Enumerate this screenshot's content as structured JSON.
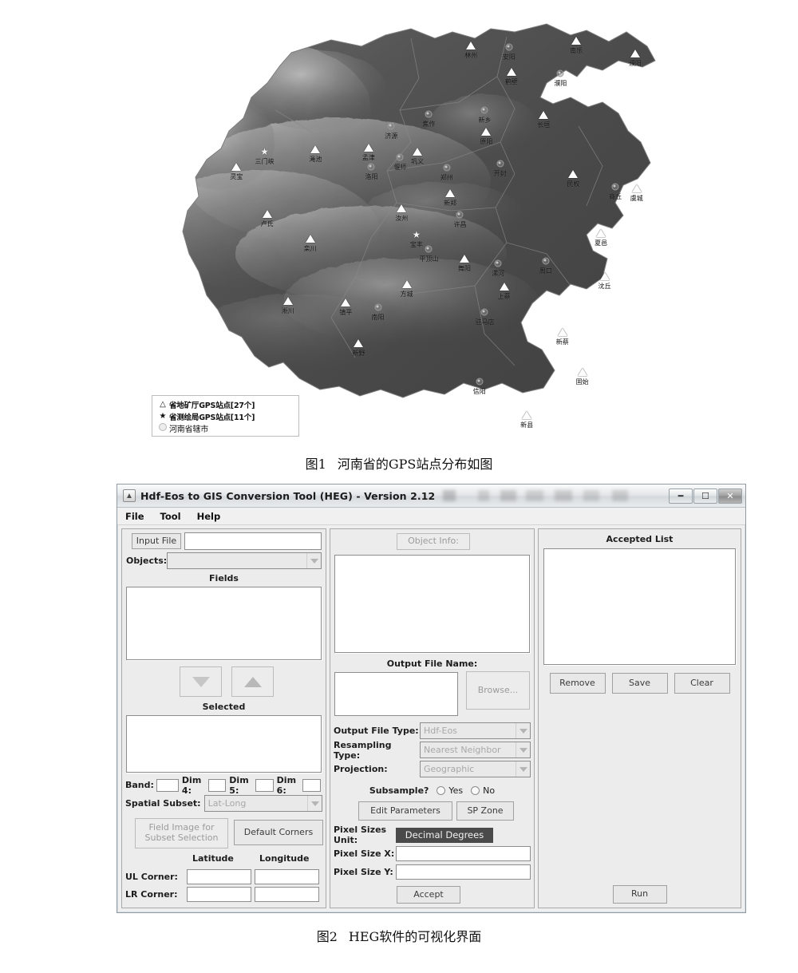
{
  "figure1": {
    "caption_num": "图1",
    "caption_text": "河南省的GPS站点分布如图",
    "legend": {
      "items": [
        {
          "symbol": "triangle-outline",
          "text": "省地矿厅GPS站点[27个]"
        },
        {
          "symbol": "star",
          "text": "省测绘局GPS站点[11个]"
        },
        {
          "symbol": "circle",
          "text": "河南省辖市"
        }
      ]
    },
    "markers": [
      {
        "label": "林州",
        "type": "triangle",
        "x": 0.605,
        "y": 0.075
      },
      {
        "label": "安阳",
        "type": "city",
        "x": 0.682,
        "y": 0.078
      },
      {
        "label": "南乐",
        "type": "triangle",
        "x": 0.818,
        "y": 0.063
      },
      {
        "label": "濮阳",
        "type": "triangle",
        "x": 0.937,
        "y": 0.095
      },
      {
        "label": "鹤壁",
        "type": "triangle",
        "x": 0.687,
        "y": 0.139
      },
      {
        "label": "濮阳",
        "type": "city",
        "x": 0.786,
        "y": 0.143
      },
      {
        "label": "焦作",
        "type": "city",
        "x": 0.52,
        "y": 0.24
      },
      {
        "label": "新乡",
        "type": "city",
        "x": 0.633,
        "y": 0.231
      },
      {
        "label": "长垣",
        "type": "triangle",
        "x": 0.752,
        "y": 0.243
      },
      {
        "label": "济源",
        "type": "city",
        "x": 0.444,
        "y": 0.27
      },
      {
        "label": "原阳",
        "type": "triangle",
        "x": 0.636,
        "y": 0.283
      },
      {
        "label": "三门峡",
        "type": "star",
        "x": 0.188,
        "y": 0.33
      },
      {
        "label": "渑池",
        "type": "triangle",
        "x": 0.291,
        "y": 0.325
      },
      {
        "label": "孟津",
        "type": "triangle",
        "x": 0.398,
        "y": 0.322
      },
      {
        "label": "偃师",
        "type": "city",
        "x": 0.462,
        "y": 0.345
      },
      {
        "label": "巩义",
        "type": "triangle",
        "x": 0.497,
        "y": 0.33
      },
      {
        "label": "郑州",
        "type": "city",
        "x": 0.556,
        "y": 0.37
      },
      {
        "label": "开封",
        "type": "city",
        "x": 0.664,
        "y": 0.36
      },
      {
        "label": "民权",
        "type": "triangle",
        "x": 0.812,
        "y": 0.385
      },
      {
        "label": "灵宝",
        "type": "triangle",
        "x": 0.131,
        "y": 0.368
      },
      {
        "label": "洛阳",
        "type": "city",
        "x": 0.404,
        "y": 0.368
      },
      {
        "label": "新郑",
        "type": "triangle",
        "x": 0.563,
        "y": 0.43
      },
      {
        "label": "商丘",
        "type": "city",
        "x": 0.897,
        "y": 0.415
      },
      {
        "label": "虞城",
        "type": "triangle",
        "x": 0.94,
        "y": 0.42
      },
      {
        "label": "汝州",
        "type": "triangle",
        "x": 0.465,
        "y": 0.468
      },
      {
        "label": "许昌",
        "type": "city",
        "x": 0.583,
        "y": 0.482
      },
      {
        "label": "卢氏",
        "type": "triangle",
        "x": 0.193,
        "y": 0.48
      },
      {
        "label": "宝丰",
        "type": "star",
        "x": 0.495,
        "y": 0.53
      },
      {
        "label": "平顶山",
        "type": "city",
        "x": 0.52,
        "y": 0.565
      },
      {
        "label": "夏邑",
        "type": "triangle",
        "x": 0.868,
        "y": 0.527
      },
      {
        "label": "栾川",
        "type": "triangle",
        "x": 0.28,
        "y": 0.54
      },
      {
        "label": "舞阳",
        "type": "triangle",
        "x": 0.592,
        "y": 0.588
      },
      {
        "label": "漯河",
        "type": "city",
        "x": 0.66,
        "y": 0.6
      },
      {
        "label": "周口",
        "type": "city",
        "x": 0.756,
        "y": 0.595
      },
      {
        "label": "沈丘",
        "type": "triangle",
        "x": 0.875,
        "y": 0.63
      },
      {
        "label": "方城",
        "type": "triangle",
        "x": 0.475,
        "y": 0.65
      },
      {
        "label": "上蔡",
        "type": "triangle",
        "x": 0.672,
        "y": 0.655
      },
      {
        "label": "淅川",
        "type": "triangle",
        "x": 0.235,
        "y": 0.69
      },
      {
        "label": "镇平",
        "type": "triangle",
        "x": 0.352,
        "y": 0.695
      },
      {
        "label": "南阳",
        "type": "city",
        "x": 0.417,
        "y": 0.705
      },
      {
        "label": "驻马店",
        "type": "city",
        "x": 0.633,
        "y": 0.718
      },
      {
        "label": "新蔡",
        "type": "triangle",
        "x": 0.79,
        "y": 0.765
      },
      {
        "label": "新野",
        "type": "triangle",
        "x": 0.378,
        "y": 0.793
      },
      {
        "label": "信阳",
        "type": "city",
        "x": 0.622,
        "y": 0.885
      },
      {
        "label": "固始",
        "type": "triangle",
        "x": 0.83,
        "y": 0.862
      },
      {
        "label": "新县",
        "type": "triangle",
        "x": 0.718,
        "y": 0.965
      }
    ]
  },
  "figure2": {
    "caption_num": "图2",
    "caption_text": "HEG软件的可视化界面",
    "window": {
      "title": "Hdf-Eos to GIS Conversion Tool (HEG) - Version 2.12",
      "icon": "app-icon",
      "buttons": {
        "minimize": "—",
        "maximize": "▣",
        "close": "✕"
      }
    },
    "menubar": [
      "File",
      "Tool",
      "Help"
    ],
    "left_panel": {
      "input_file_button": "Input File",
      "input_file_value": "",
      "objects_label": "Objects:",
      "objects_value": "",
      "fields_label": "Fields",
      "fields_items": [],
      "move_down_icon": "arrow-down-icon",
      "move_up_icon": "arrow-up-icon",
      "selected_label": "Selected",
      "selected_items": [],
      "dims": [
        {
          "label": "Band:",
          "value": ""
        },
        {
          "label": "Dim 4:",
          "value": ""
        },
        {
          "label": "Dim 5:",
          "value": ""
        },
        {
          "label": "Dim 6:",
          "value": ""
        }
      ],
      "spatial_subset_label": "Spatial Subset:",
      "spatial_subset_value": "Lat-Long",
      "field_image_button_line1": "Field Image for",
      "field_image_button_line2": "Subset Selection",
      "default_corners_button": "Default Corners",
      "corner_headers": {
        "latitude": "Latitude",
        "longitude": "Longitude"
      },
      "corners": [
        {
          "label": "UL Corner:",
          "lat": "",
          "lon": ""
        },
        {
          "label": "LR Corner:",
          "lat": "",
          "lon": ""
        }
      ]
    },
    "mid_panel": {
      "object_info_button": "Object Info:",
      "object_info_items": [],
      "output_file_label": "Output File Name:",
      "output_file_value": "",
      "browse_button": "Browse...",
      "output_file_type_label": "Output File Type:",
      "output_file_type_value": "Hdf-Eos",
      "resampling_type_label": "Resampling Type:",
      "resampling_type_value": "Nearest Neighbor",
      "projection_label": "Projection:",
      "projection_value": "Geographic",
      "subsample_label": "Subsample?",
      "subsample_options": [
        "Yes",
        "No"
      ],
      "edit_parameters_button": "Edit Parameters",
      "sp_zone_button": "SP Zone",
      "pixel_sizes_unit_label": "Pixel Sizes Unit:",
      "pixel_sizes_unit_value": "Decimal Degrees",
      "pixel_size_x_label": "Pixel Size X:",
      "pixel_size_x_value": "",
      "pixel_size_y_label": "Pixel Size Y:",
      "pixel_size_y_value": "",
      "accept_button": "Accept"
    },
    "right_panel": {
      "accepted_list_label": "Accepted List",
      "accepted_items": [],
      "remove_button": "Remove",
      "save_button": "Save",
      "clear_button": "Clear",
      "run_button": "Run"
    }
  },
  "colors": {
    "window_bg": "#efefef",
    "panel_bg": "#ececec",
    "field_bg": "#ffffff",
    "highlight_bg": "#4a4a4a",
    "highlight_fg": "#f2f2f2",
    "border": "#8d8d8d",
    "disabled_text": "#a8a8a8"
  }
}
